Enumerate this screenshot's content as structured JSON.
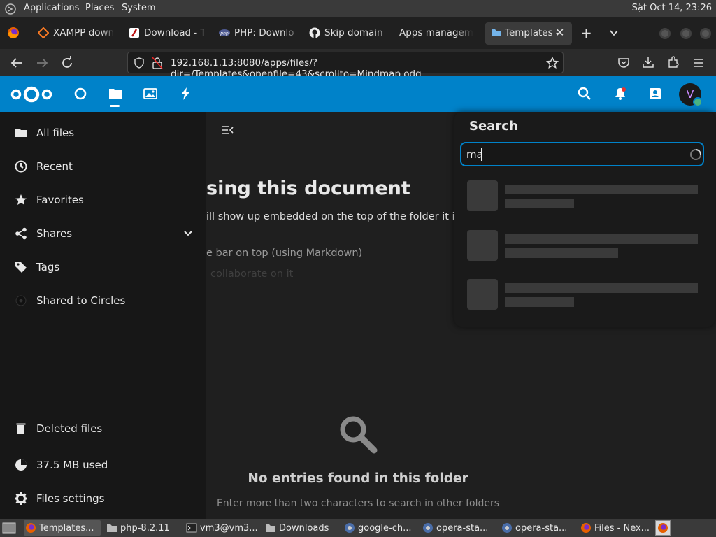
{
  "system_bar": {
    "menus": [
      "Applications",
      "Places",
      "System"
    ],
    "clock": "Sat Oct 14, 23:26"
  },
  "browser": {
    "tabs": [
      {
        "label": "XAMPP downl",
        "icon": "xampp-icon"
      },
      {
        "label": "Download - Th",
        "icon": "filezilla-icon"
      },
      {
        "label": "PHP: Downloa",
        "icon": "php-icon"
      },
      {
        "label": "Skip domain v",
        "icon": "github-icon"
      },
      {
        "label": "Apps managem",
        "icon": "none"
      },
      {
        "label": "Templates -",
        "icon": "folder-icon",
        "active": true
      }
    ],
    "url": "192.168.1.13:8080/apps/files/?dir=/Templates&openfile=43&scrollto=Mindmap.odg"
  },
  "nextcloud": {
    "accent": "#0082c9",
    "avatar_letter": "V",
    "sidebar": {
      "items": [
        {
          "label": "All files",
          "icon": "folder-icon"
        },
        {
          "label": "Recent",
          "icon": "clock-icon"
        },
        {
          "label": "Favorites",
          "icon": "star-icon"
        },
        {
          "label": "Shares",
          "icon": "share-icon"
        },
        {
          "label": "Tags",
          "icon": "tag-icon"
        },
        {
          "label": "Shared to Circles",
          "icon": "circles-icon"
        }
      ],
      "footer": [
        {
          "label": "Deleted files",
          "icon": "trash-icon"
        },
        {
          "label": "37.5 MB used",
          "icon": "pie-chart-icon"
        },
        {
          "label": "Files settings",
          "icon": "gear-icon"
        }
      ]
    },
    "main": {
      "heading_fragment": "sing this document",
      "line1": "ill show up embedded on the top of the folder it is in (",
      "line2": "e bar on top (using Markdown)",
      "line3": "collaborate on it",
      "empty_title": "No entries found in this folder",
      "empty_subtitle": "Enter more than two characters to search in other folders"
    },
    "search": {
      "title": "Search",
      "query": "ma"
    }
  },
  "taskbar": {
    "items": [
      {
        "label": "Templates...",
        "icon": "firefox-icon",
        "active": true
      },
      {
        "label": "php-8.2.11",
        "icon": "folder-icon"
      },
      {
        "label": "vm3@vm3...",
        "icon": "terminal-icon"
      },
      {
        "label": "Downloads",
        "icon": "folder-icon"
      },
      {
        "label": "google-ch...",
        "icon": "package-icon"
      },
      {
        "label": "opera-sta...",
        "icon": "package-icon"
      },
      {
        "label": "opera-sta...",
        "icon": "package-icon"
      },
      {
        "label": "Files - Nex...",
        "icon": "firefox-icon"
      }
    ]
  }
}
